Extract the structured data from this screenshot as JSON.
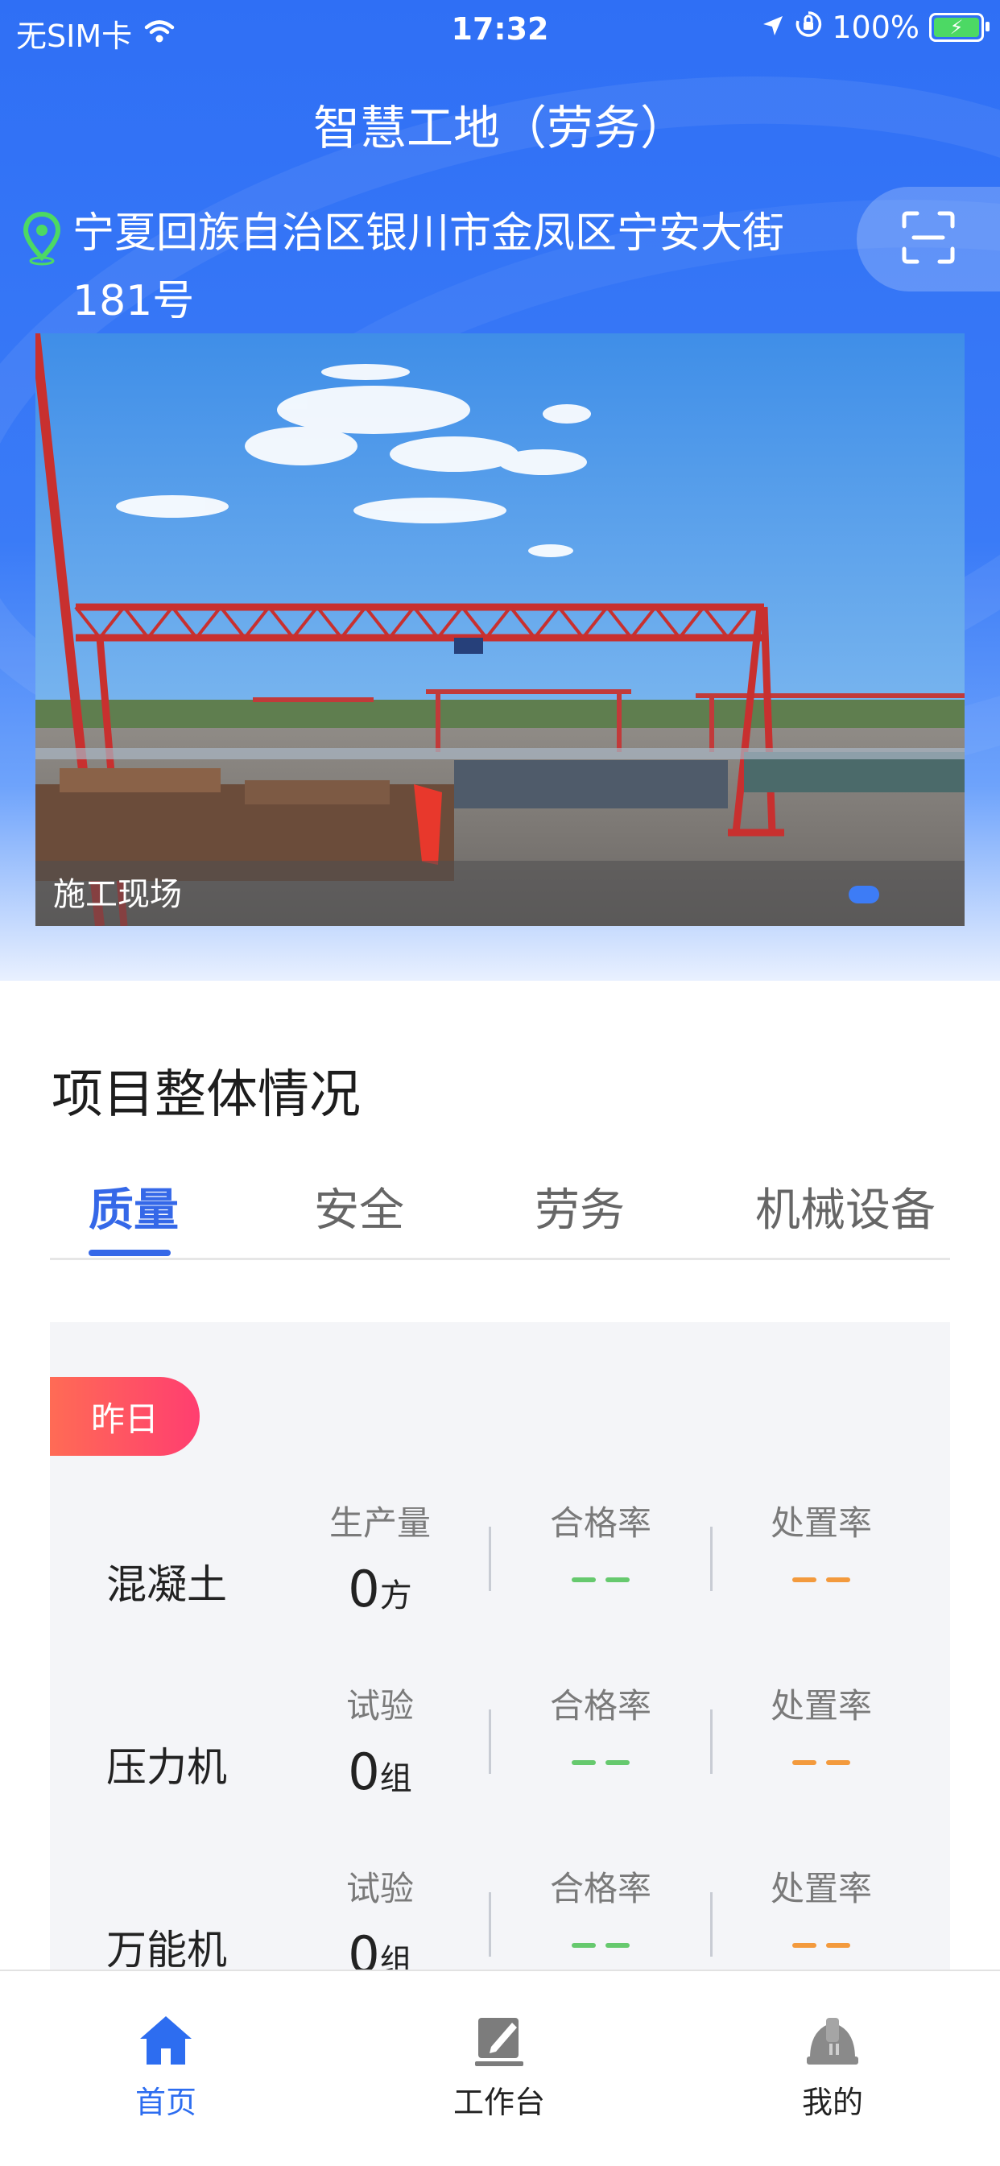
{
  "status_bar": {
    "carrier": "无SIM卡",
    "time": "17:32",
    "battery": "100%"
  },
  "header": {
    "title": "智慧工地（劳务）",
    "location": "宁夏回族自治区银川市金凤区宁安大街181号"
  },
  "banner": {
    "caption": "施工现场"
  },
  "overview": {
    "title": "项目整体情况",
    "tabs": [
      {
        "label": "质量",
        "active": true
      },
      {
        "label": "安全",
        "active": false
      },
      {
        "label": "劳务",
        "active": false
      },
      {
        "label": "机械设备",
        "active": false
      }
    ],
    "period_badge": "昨日",
    "rows": [
      {
        "name": "混凝土",
        "metric_label": "生产量",
        "value": "0",
        "unit": "方",
        "pass_label": "合格率",
        "pass_value": "——",
        "handle_label": "处置率",
        "handle_value": "——"
      },
      {
        "name": "压力机",
        "metric_label": "试验",
        "value": "0",
        "unit": "组",
        "pass_label": "合格率",
        "pass_value": "——",
        "handle_label": "处置率",
        "handle_value": "——"
      },
      {
        "name": "万能机",
        "metric_label": "试验",
        "value": "0",
        "unit": "组",
        "pass_label": "合格率",
        "pass_value": "——",
        "handle_label": "处置率",
        "handle_value": "——"
      }
    ]
  },
  "tabbar": {
    "items": [
      {
        "label": "首页",
        "icon": "home-icon",
        "active": true
      },
      {
        "label": "工作台",
        "icon": "workbench-icon",
        "active": false
      },
      {
        "label": "我的",
        "icon": "helmet-icon",
        "active": false
      }
    ]
  },
  "colors": {
    "primary": "#3568e8",
    "badge_gradient_start": "#ff6b55",
    "badge_gradient_end": "#ff3e70",
    "pass_dash": "#66c96e",
    "handle_dash": "#f39a3d"
  }
}
